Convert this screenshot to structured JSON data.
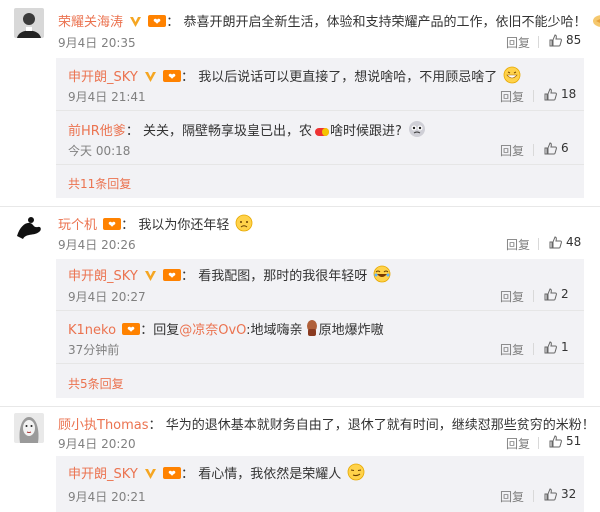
{
  "comments": [
    {
      "user": "荣耀关海涛",
      "text": "恭喜开朗开启全新生活，体验和支持荣耀产品的工作，依旧不能少哈！",
      "time": "9月4日 20:35",
      "reply_label": "回复",
      "likes": "85",
      "replies": [
        {
          "user": "申开朗_SKY",
          "text": "我以后说话可以更直接了，想说啥哈，不用顾忌啥了",
          "time": "9月4日 21:41",
          "reply_label": "回复",
          "likes": "18"
        },
        {
          "user": "前HR他爹",
          "text": "关关，隔壁畅享圾皇已出，农",
          "text2": "啥时候跟进?",
          "time": "今天 00:18",
          "reply_label": "回复",
          "likes": "6"
        }
      ],
      "more": "共11条回复"
    },
    {
      "user": "玩个机",
      "text": "我以为你还年轻",
      "time": "9月4日 20:26",
      "reply_label": "回复",
      "likes": "48",
      "replies": [
        {
          "user": "申开朗_SKY",
          "text": "看我配图，那时的我很年轻呀",
          "time": "9月4日 20:27",
          "reply_label": "回复",
          "likes": "2"
        },
        {
          "user": "K1neko",
          "prefix": "回复",
          "mention": "@凉奈OvO",
          "text": ":地域嗨亲",
          "text2": "原地爆炸嗷",
          "time": "37分钟前",
          "reply_label": "回复",
          "likes": "1"
        }
      ],
      "more": "共5条回复"
    },
    {
      "user": "顾小执Thomas",
      "text": "华为的退休基本就财务自由了，退休了就有时间，继续怼那些贫穷的米粉！",
      "time": "9月4日 20:20",
      "reply_label": "回复",
      "likes": "51",
      "replies": [
        {
          "user": "申开朗_SKY",
          "text": "看心情，我依然是荣耀人",
          "time": "9月4日 20:21",
          "reply_label": "回复",
          "likes": "32"
        }
      ]
    }
  ],
  "colors": {
    "name": "#eb7350",
    "meta": "#808080",
    "reply_bg": "#f2f2f5",
    "vip": "#f5a623",
    "badge": "#ff8200"
  }
}
